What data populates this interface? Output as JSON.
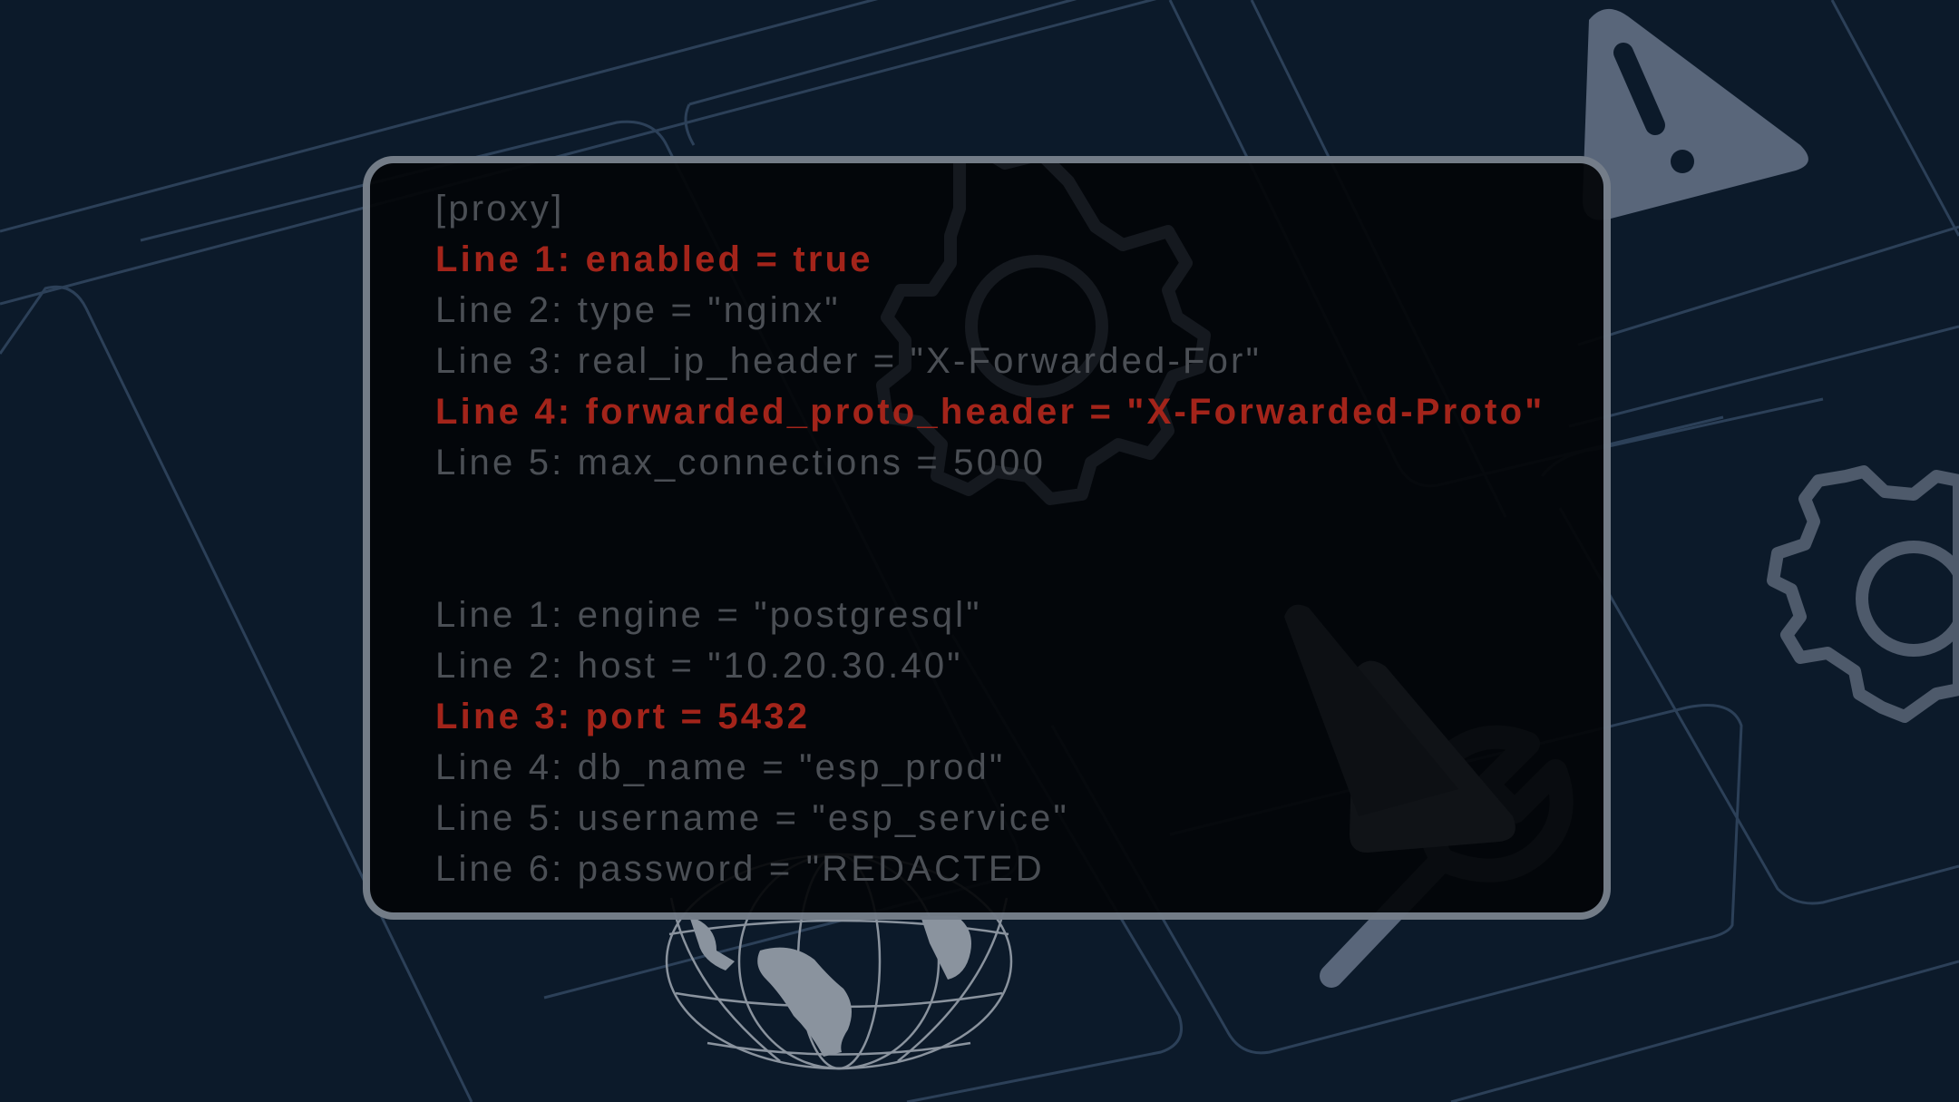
{
  "config_view": {
    "sections": [
      {
        "header": "[proxy]",
        "lines": [
          {
            "text": "Line 1: enabled = true",
            "highlighted": true
          },
          {
            "text": "Line 2: type = \"nginx\"",
            "highlighted": false
          },
          {
            "text": "Line 3: real_ip_header = \"X-Forwarded-For\"",
            "highlighted": false
          },
          {
            "text": "Line 4: forwarded_proto_header = \"X-Forwarded-Proto\"",
            "highlighted": true
          },
          {
            "text": "Line 5: max_connections = 5000",
            "highlighted": false
          }
        ]
      },
      {
        "header": "",
        "lines": [
          {
            "text": "Line 1: engine = \"postgresql\"",
            "highlighted": false
          },
          {
            "text": "Line 2: host = \"10.20.30.40\"",
            "highlighted": false
          },
          {
            "text": "Line 3: port = 5432",
            "highlighted": true
          },
          {
            "text": "Line 4: db_name = \"esp_prod\"",
            "highlighted": false
          },
          {
            "text": "Line 5: username = \"esp_service\"",
            "highlighted": false
          },
          {
            "text": "Line 6: password = \"REDACTED",
            "highlighted": false
          }
        ]
      }
    ]
  },
  "colors": {
    "background": "#0c1a2a",
    "text_dim": "#4b4f55",
    "text_highlight": "#a3241a",
    "frame": "#949eac",
    "icon": "#8a93a0"
  },
  "decor_icons": [
    "gear-icon",
    "warning-icon",
    "globe-icon",
    "wrench-icon"
  ]
}
